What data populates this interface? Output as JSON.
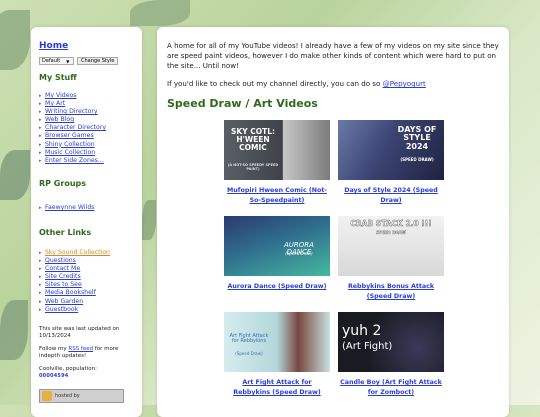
{
  "sidebar": {
    "home_label": "Home",
    "style_select_value": "Default",
    "style_button_label": "Change Style",
    "my_stuff": {
      "heading": "My Stuff",
      "links": [
        "My Videos",
        "My Art",
        "Writing Directory",
        "Web Blog",
        "Character Directory",
        "Browser Games",
        "Shiny Collection",
        "Music Collection",
        "Enter Side Zones..."
      ]
    },
    "rp_groups": {
      "heading": "RP Groups",
      "links": [
        "Faewynne Wilds"
      ]
    },
    "other_links": {
      "heading": "Other Links",
      "links": [
        "Sky Sound Collection",
        "Questions",
        "Contact Me",
        "Site Credits",
        "Sites to See",
        "Media Bookshelf",
        "Web Garden",
        "Guestbook"
      ]
    },
    "updated_text": "This site was last updated on 10/13/2024",
    "follow_prefix": "Follow my ",
    "rss_label": "RSS feed",
    "follow_suffix": " for more indepth updates!",
    "population_label": "Coolville, population:",
    "population_value": "00004594",
    "badge_text": "hosted by"
  },
  "main": {
    "intro": "A home for all of my YouTube videos! I already have a few of my videos on my site since they are speed paint videos, however I do make other kinds of content which were hard to put on the site... Until now!",
    "channel_prefix": "If you'd like to check out my channel directly, you can do so ",
    "channel_link": "@Pepyogurt",
    "section_title": "Speed Draw / Art Videos",
    "videos": [
      {
        "caption": "Mufopiri Hween Comic (Not-So-Speedpaint)",
        "thumb_text": "SKY COTL: H'WEEN COMIC",
        "thumb_sub": "(A NOT-SO SPEEDY SPEED PAINT)"
      },
      {
        "caption": "Days of Style 2024 (Speed Draw)",
        "thumb_text": "DAYS OF STYLE 2024",
        "thumb_sub": "(SPEED DRAW)"
      },
      {
        "caption": "Aurora Dance (Speed Draw)",
        "thumb_text": "AURORA DANCE",
        "thumb_sub": "(Speed Draw)"
      },
      {
        "caption": "Rebbykins Bonus Attack (Speed Draw)",
        "thumb_text": "CRAB STACK 2.0 !!!",
        "thumb_sub": "SPEED DRAW"
      },
      {
        "caption": "Art Fight Attack for Rebbykins (Speed Draw)",
        "thumb_text": "Art Fight Attack for Rebbykins",
        "thumb_sub": "(Speed Draw)"
      },
      {
        "caption": "Candle Boy (Art Fight Attack for Zomboct)",
        "thumb_text": "yuh 2",
        "thumb_sub": "(Art Fight)"
      }
    ]
  },
  "colors": {
    "link": "#2b3cd0",
    "heading_green": "#2f6a1b",
    "link_orange": "#d28a25"
  }
}
